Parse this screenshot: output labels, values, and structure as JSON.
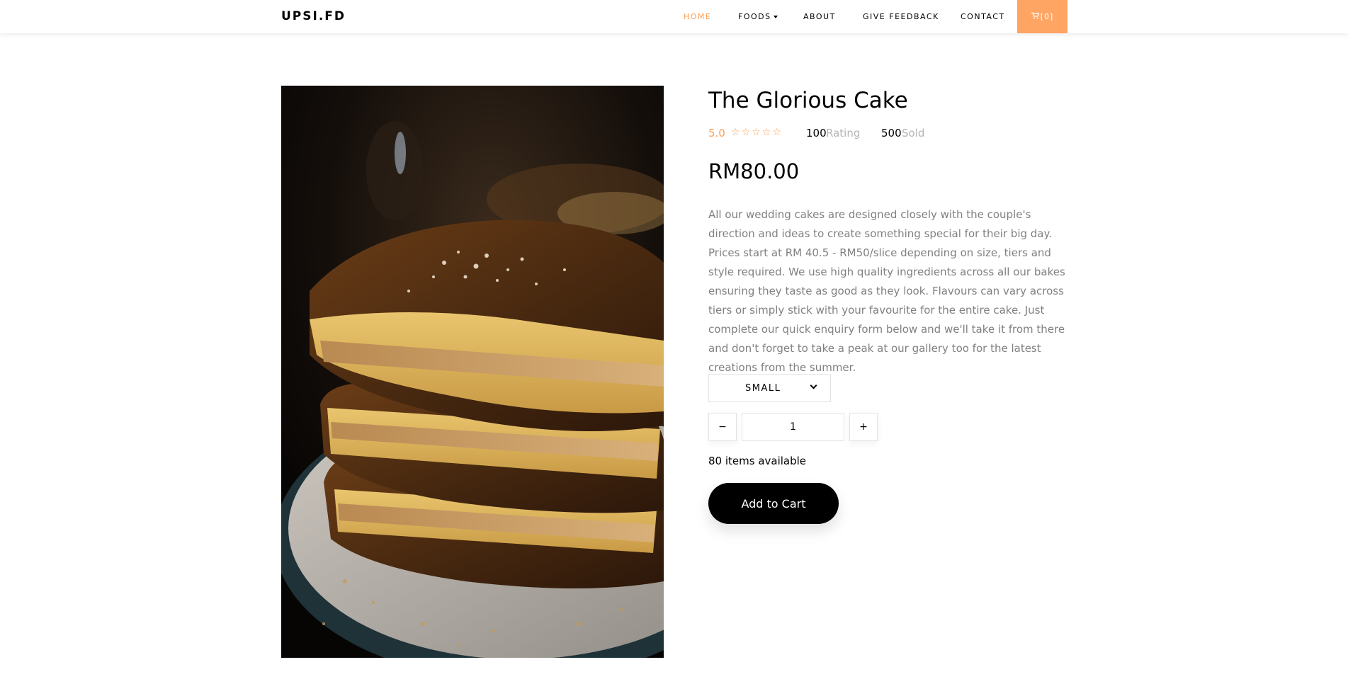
{
  "nav": {
    "brand": "UPSI.FD",
    "items": [
      {
        "label": "HOME",
        "active": true
      },
      {
        "label": "FOODS",
        "dropdown": true
      },
      {
        "label": "ABOUT"
      },
      {
        "label": "GIVE FEEDBACK"
      },
      {
        "label": "CONTACT"
      }
    ],
    "cart_label": "[0]",
    "cart_icon": "cart-icon"
  },
  "product": {
    "image_alt": "Stacked slices of apam balik pancake on a plate",
    "title": "The Glorious Cake",
    "rating_value": "5.0",
    "stars": "☆☆☆☆☆",
    "rating_count": "100",
    "rating_label": "Rating",
    "sold_count": "500",
    "sold_label": "Sold",
    "price": "RM80.00",
    "description": "All our wedding cakes are designed closely with the couple's direction and ideas to create something special for their big day. Prices start at RM 40.5 - RM50/slice depending on size, tiers and style required. We use high quality ingredients across all our bakes ensuring they taste as good as they look. Flavours can vary across tiers or simply stick with your favourite for the entire cake. Just complete our quick enquiry form below and we'll take it from there and don't forget to take a peak at our gallery too for the latest creations from the summer.",
    "size_selected": "SMALL",
    "qty_minus": "−",
    "qty_plus": "+",
    "quantity": "1",
    "availability": "80 items available",
    "add_to_cart": "Add to Cart"
  },
  "colors": {
    "accent": "#ff9f55",
    "cart_bg": "#ffa563",
    "muted_text": "#808080"
  }
}
